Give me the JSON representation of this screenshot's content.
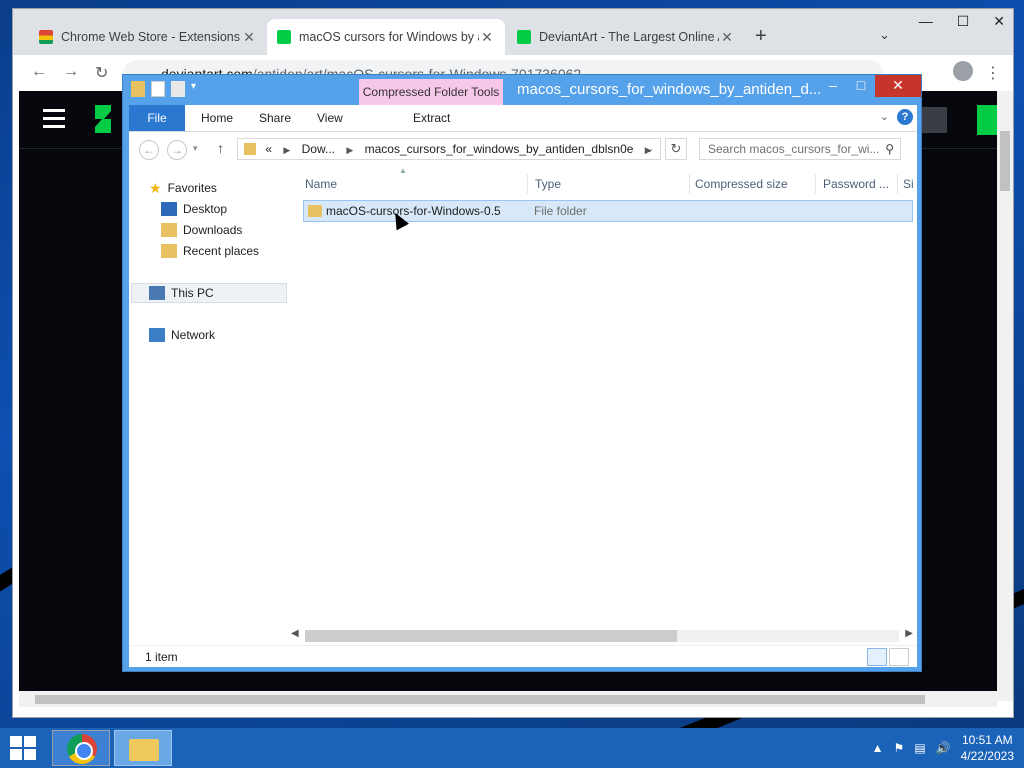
{
  "chrome": {
    "tabs": [
      {
        "title": "Chrome Web Store - Extensions",
        "close": "✕"
      },
      {
        "title": "macOS cursors for Windows by a",
        "close": "✕"
      },
      {
        "title": "DeviantArt - The Largest Online A",
        "close": "✕"
      }
    ],
    "new_tab": "+",
    "tab_search": "⌄",
    "window_controls": {
      "minimize": "—",
      "maximize": "☐",
      "close": "✕"
    },
    "url_domain": "deviantart.com",
    "url_path": "/antiden/art/macOS-cursors-for-Windows-701736062"
  },
  "explorer": {
    "context_tab": "Compressed Folder Tools",
    "title": "macos_cursors_for_windows_by_antiden_d...",
    "ribbon_tabs": [
      "File",
      "Home",
      "Share",
      "View",
      "Extract"
    ],
    "help": "?",
    "address": {
      "prefix": "«",
      "crumbs": [
        "Dow...",
        "macos_cursors_for_windows_by_antiden_dblsn0e"
      ]
    },
    "search_placeholder": "Search macos_cursors_for_wi...",
    "nav": {
      "favorites": "Favorites",
      "desktop": "Desktop",
      "downloads": "Downloads",
      "recent": "Recent places",
      "this_pc": "This PC",
      "network": "Network"
    },
    "columns": [
      "Name",
      "Type",
      "Compressed size",
      "Password ...",
      "Si"
    ],
    "rows": [
      {
        "name": "macOS-cursors-for-Windows-0.5",
        "type": "File folder"
      }
    ],
    "status": "1 item"
  },
  "taskbar": {
    "time": "10:51 AM",
    "date": "4/22/2023"
  },
  "colors": {
    "explorer_frame": "#56a2ea",
    "context_tab": "#f6c7e8",
    "file_tab": "#2b78d0",
    "taskbar": "#1b63b8",
    "deviantart_green": "#05cc47"
  }
}
